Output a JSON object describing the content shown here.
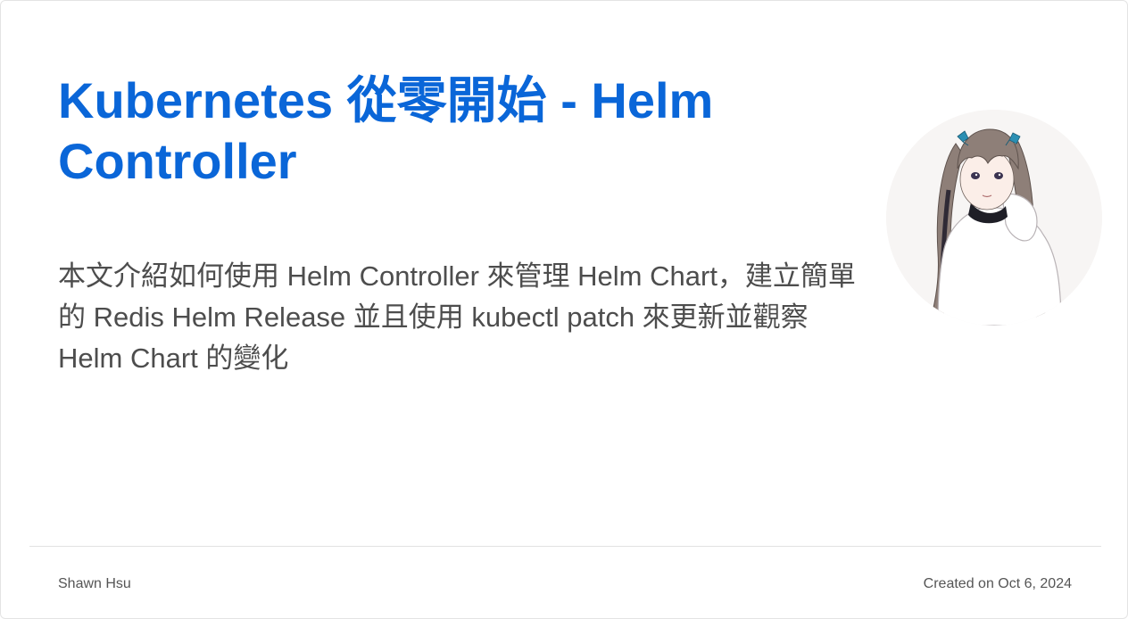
{
  "post": {
    "title": "Kubernetes 從零開始 - Helm Controller",
    "description": "本文介紹如何使用 Helm Controller 來管理 Helm Chart，建立簡單的 Redis Helm Release 並且使用 kubectl patch 來更新並觀察 Helm Chart 的變化"
  },
  "footer": {
    "author": "Shawn Hsu",
    "created": "Created on Oct 6, 2024"
  },
  "avatar": {
    "icon": "anime-girl-avatar-icon"
  },
  "colors": {
    "title": "#0a66d8",
    "text": "#4d4d4d",
    "meta": "#555555",
    "divider": "#e2e2e2"
  }
}
